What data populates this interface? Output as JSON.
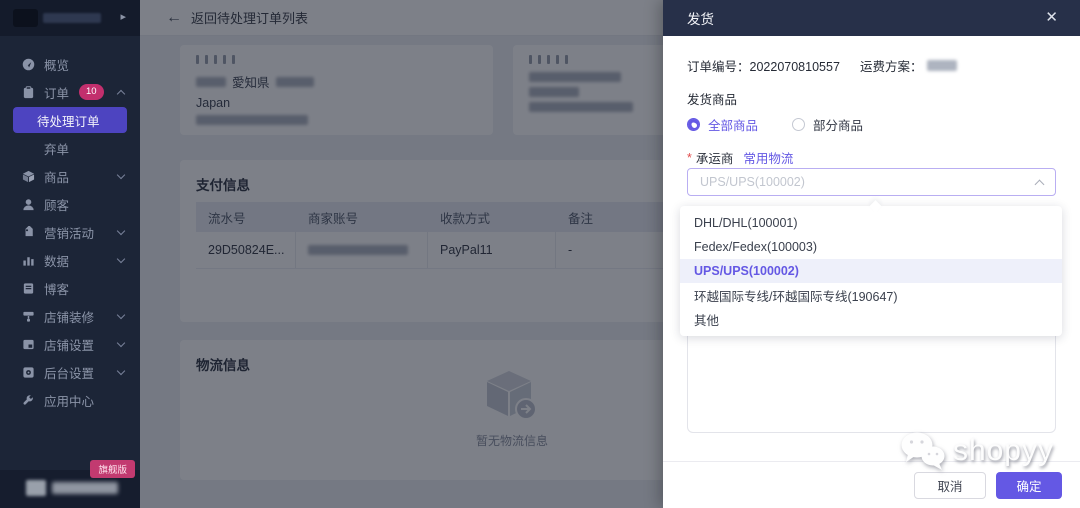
{
  "sidebar": {
    "collapse_icon": "▸",
    "items": [
      {
        "label": "概览"
      },
      {
        "label": "订单",
        "badge": "10"
      },
      {
        "label": "待处理订单"
      },
      {
        "label": "弃单"
      },
      {
        "label": "商品"
      },
      {
        "label": "顾客"
      },
      {
        "label": "营销活动"
      },
      {
        "label": "数据"
      },
      {
        "label": "博客"
      },
      {
        "label": "店铺装修"
      },
      {
        "label": "店铺设置"
      },
      {
        "label": "后台设置"
      },
      {
        "label": "应用中心"
      }
    ],
    "edition_badge": "旗舰版"
  },
  "header": {
    "back_icon": "←",
    "back_label": "返回待处理订单列表"
  },
  "main": {
    "address_card": {
      "region": "愛知県",
      "country": "Japan"
    },
    "payment_card": {
      "title": "支付信息",
      "table": {
        "headers": [
          "流水号",
          "商家账号",
          "收款方式",
          "备注"
        ],
        "row": [
          "29D50824E...",
          "",
          "PayPal11",
          "-"
        ]
      }
    },
    "logistics_card": {
      "title": "物流信息",
      "empty_text": "暂无物流信息"
    }
  },
  "modal": {
    "title": "发货",
    "close_icon": "✕",
    "order_no_label": "订单编号：",
    "order_no": "2022070810557",
    "freight_label": "运费方案：",
    "section_products": "发货商品",
    "radio_all": "全部商品",
    "radio_partial": "部分商品",
    "required_mark": "*",
    "carrier_label": "承运商",
    "carrier_link": "常用物流",
    "select_value": "UPS/UPS(100002)",
    "dropdown": {
      "options": [
        {
          "label": "DHL/DHL(100001)"
        },
        {
          "label": "Fedex/Fedex(100003)"
        },
        {
          "label": "UPS/UPS(100002)",
          "selected": true
        },
        {
          "label": "环越国际专线/环越国际专线(190647)"
        },
        {
          "label": "其他"
        }
      ]
    },
    "cancel_label": "取消",
    "confirm_label": "确定"
  },
  "watermark": {
    "text": "shopyy"
  },
  "colors": {
    "accent": "#6458e4",
    "badge_pink": "#c22f6d",
    "sidebar_bg": "#1c2537",
    "modal_header": "#273049",
    "sidebar_active": "#4d44c0"
  }
}
